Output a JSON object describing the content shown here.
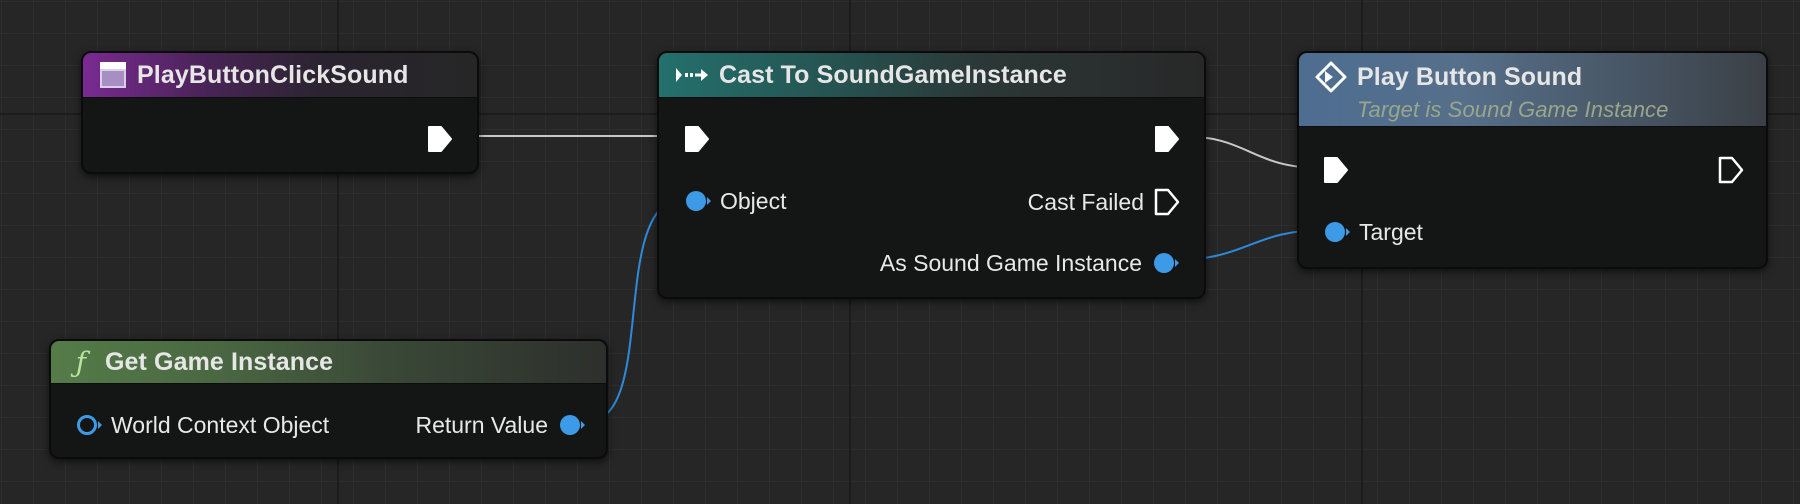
{
  "nodes": {
    "event": {
      "title": "PlayButtonClickSound",
      "header_color": "#7a2a92"
    },
    "cast": {
      "title": "Cast To SoundGameInstance",
      "header_color": "#23706c",
      "pins": {
        "object": "Object",
        "cast_failed": "Cast Failed",
        "as_instance": "As Sound Game Instance"
      }
    },
    "play": {
      "title": "Play Button Sound",
      "subtitle": "Target is Sound Game Instance",
      "header_color": "#4d6d91",
      "pins": {
        "target": "Target"
      }
    },
    "get_instance": {
      "title": "Get Game Instance",
      "header_color": "#547c48",
      "pins": {
        "world_context": "World Context Object",
        "return_value": "Return Value"
      }
    }
  },
  "colors": {
    "exec_wire": "#c8c8c8",
    "object_pin": "#3d9ae6",
    "object_wire": "#2e8ad8"
  },
  "icons": {
    "event": "event-window-icon",
    "cast": "cast-arrows-icon",
    "function": "function-f-icon",
    "call": "call-diamond-icon"
  }
}
